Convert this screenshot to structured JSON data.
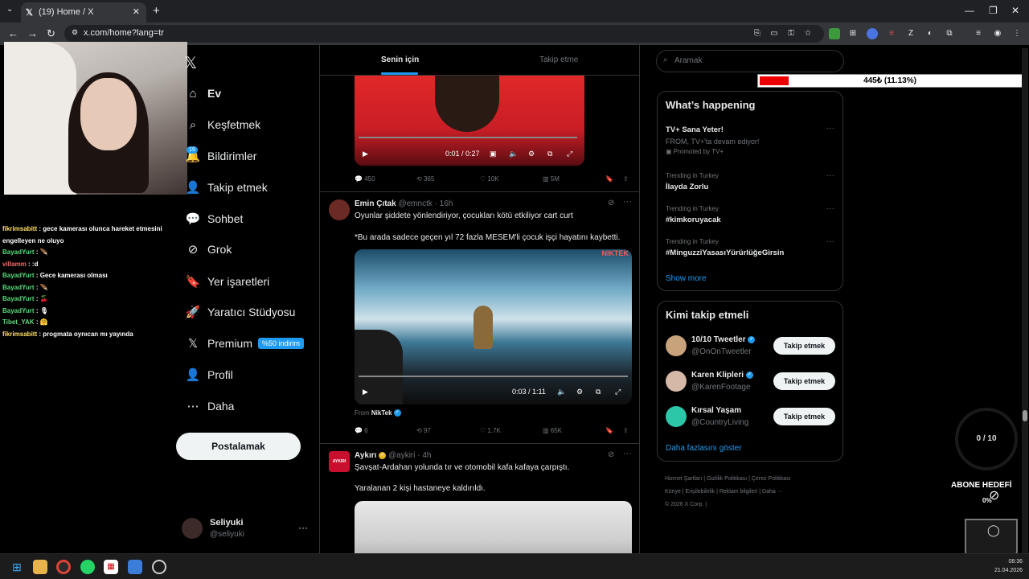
{
  "browser": {
    "tab_title": "(19) Home / X",
    "url": "x.com/home?lang=tr",
    "new_tab": "+",
    "tab_close": "✕"
  },
  "chat": [
    {
      "user": "fikrimsabitt",
      "msg": ": gece kamerası olunca hareket etmesini engelleyen ne oluyo",
      "color": "yellow"
    },
    {
      "user": "BayadYurt",
      "msg": ": 🪶",
      "color": "green"
    },
    {
      "user": "villamm",
      "msg": ": :d",
      "color": "red"
    },
    {
      "user": "BayadYurt",
      "msg": ": Gece kamerası olması",
      "color": "green"
    },
    {
      "user": "BayadYurt",
      "msg": ": 🪶",
      "color": "green"
    },
    {
      "user": "BayadYurt",
      "msg": ": 🍒",
      "color": "green"
    },
    {
      "user": "BayadYurt",
      "msg": ": 🎙",
      "color": "green"
    },
    {
      "user": "Tibet_YAK",
      "msg": ": 🤗",
      "color": "green"
    },
    {
      "user": "fikrimsabitt",
      "msg": ": progmata oynıcan mı yayında",
      "color": "yellow"
    }
  ],
  "nav": {
    "logo": "𝕏",
    "items": [
      {
        "label": "Ev",
        "icon": "⌂"
      },
      {
        "label": "Keşfetmek",
        "icon": "⌕"
      },
      {
        "label": "Bildirimler",
        "icon": "🔔"
      },
      {
        "label": "Takip etmek",
        "icon": "👤"
      },
      {
        "label": "Sohbet",
        "icon": "💬"
      },
      {
        "label": "Grok",
        "icon": "⊘"
      },
      {
        "label": "Yer işaretleri",
        "icon": "🔖"
      },
      {
        "label": "Yaratıcı Stüdyosu",
        "icon": "🚀"
      },
      {
        "label": "Premium",
        "icon": "𝕏"
      },
      {
        "label": "Profil",
        "icon": "👤"
      },
      {
        "label": "Daha",
        "icon": "⋯"
      }
    ],
    "notif_badge": "19",
    "premium_badge": "%50 indirim",
    "post_button": "Postalamak",
    "account": {
      "name": "Seliyuki",
      "handle": "@seliyuki",
      "more": "···"
    }
  },
  "feed": {
    "tabs": [
      "Senin için",
      "Takip etme"
    ],
    "tweet0": {
      "video_time": "0:01 / 0:27",
      "stats": {
        "replies": "450",
        "reposts": "365",
        "likes": "10K",
        "views": "5M"
      }
    },
    "tweet1": {
      "name": "Emin Çıtak",
      "handle": "@emnctk",
      "time": "· 16h",
      "line1": "Oyunlar şiddete yönlendiriyor, çocukları kötü etkiliyor cart curt",
      "line2": "*Bu arada sadece geçen yıl 72 fazla MESEM'li çocuk işçi hayatını kaybetti.",
      "video_watermark": "NIKTEK",
      "video_time": "0:03 / 1:11",
      "from_label": "From",
      "from_source": "NikTek",
      "stats": {
        "replies": "6",
        "reposts": "97",
        "likes": "1.7K",
        "views": "65K"
      }
    },
    "tweet2": {
      "name": "Aykırı",
      "handle": "@aykiri",
      "time": "· 4h",
      "avatar_text": "AYKIRI",
      "line1": "Şavşat-Ardahan yolunda tır ve otomobil kafa kafaya çarpıştı.",
      "line2": "Yaralanan 2 kişi hastaneye kaldırıldı."
    }
  },
  "right": {
    "search_placeholder": "Aramak",
    "progress": {
      "text": "445₺ (11.13%)",
      "fraction": 0.1113
    },
    "happening": {
      "title": "What’s happening",
      "promo": {
        "title": "TV+ Sana Yeter!",
        "sub": "FROM, TV+'ta devam ediyor!",
        "promoted": "Promoted by TV+"
      },
      "trends": [
        {
          "context": "Trending in Turkey",
          "title": "İlayda Zorlu"
        },
        {
          "context": "Trending in Turkey",
          "title": "#kimkoruyacak"
        },
        {
          "context": "Trending in Turkey",
          "title": "#MinguzziYasasıYürürlüğeGirsin"
        }
      ],
      "show_more": "Show more"
    },
    "who_to_follow": {
      "title": "Kimi takip etmeli",
      "users": [
        {
          "name": "10/10 Tweetler",
          "handle": "@OnOnTweetler"
        },
        {
          "name": "Karen Klipleri",
          "handle": "@KarenFootage"
        },
        {
          "name": "Kırsal Yaşam",
          "handle": "@CountryLiving"
        }
      ],
      "follow_label": "Takip etmek",
      "show_more": "Daha fazlasını göster"
    },
    "footer": [
      "Hizmet Şartları",
      "Gizlilik Politikası",
      "Çerez Politikası",
      "Künye",
      "Erişilebilirlik",
      "Reklam bilgileri",
      "Daha ···",
      "© 2026 X Corp."
    ]
  },
  "overlay": {
    "goal": "0 / 10",
    "abone": "ABONE HEDEFİ",
    "abone_pct": "0%"
  },
  "taskbar": {
    "time": "08:36",
    "date": "21.04.2026"
  },
  "colors": {
    "accent": "#1d9bf0",
    "bg": "#000000",
    "progress_fill": "#ee0000"
  }
}
